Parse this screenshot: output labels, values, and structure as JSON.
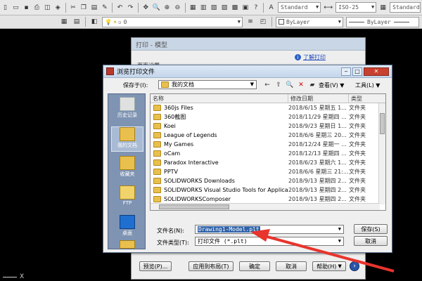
{
  "toolbar": {
    "text_style": "Standard",
    "dim_style": "ISO-25",
    "table_style": "Standard",
    "layer_value": "0",
    "color_value": "ByLayer",
    "linetype_value": "ByLayer"
  },
  "print_dialog": {
    "title": "打印 - 模型",
    "link": "了解打印",
    "page_setup": "页面设置",
    "buttons": {
      "preview": "预览(P)...",
      "apply_layout": "应用到布局(T)",
      "ok": "确定",
      "cancel": "取消",
      "help": "帮助(H)"
    }
  },
  "file_dialog": {
    "title": "浏览打印文件",
    "save_in_label": "保存于(I):",
    "save_in_value": "我的文档",
    "view_label": "查看(V)",
    "tools_label": "工具(L)",
    "places": [
      {
        "label": "历史记录"
      },
      {
        "label": "我的文档"
      },
      {
        "label": "收藏夹"
      },
      {
        "label": "FTP"
      },
      {
        "label": "桌面"
      }
    ],
    "columns": {
      "name": "名称",
      "date": "修改日期",
      "type": "类型"
    },
    "files": [
      {
        "name": "360js Files",
        "date": "2018/6/15 星期五 1...",
        "type": "文件夹"
      },
      {
        "name": "360截图",
        "date": "2018/11/29 星期四 ...",
        "type": "文件夹"
      },
      {
        "name": "Koei",
        "date": "2018/9/23 星期日 1...",
        "type": "文件夹"
      },
      {
        "name": "League of Legends",
        "date": "2018/6/6 星期三 20...",
        "type": "文件夹"
      },
      {
        "name": "My Games",
        "date": "2018/12/24 星期一 ...",
        "type": "文件夹"
      },
      {
        "name": "oCam",
        "date": "2018/12/13 星期四 ...",
        "type": "文件夹"
      },
      {
        "name": "Paradox Interactive",
        "date": "2018/6/23 星期六 1...",
        "type": "文件夹"
      },
      {
        "name": "PPTV",
        "date": "2018/6/6 星期三 21:...",
        "type": "文件夹"
      },
      {
        "name": "SOLIDWORKS Downloads",
        "date": "2018/9/13 星期四 2...",
        "type": "文件夹"
      },
      {
        "name": "SOLIDWORKS Visual Studio Tools for Applica...",
        "date": "2018/9/13 星期四 2...",
        "type": "文件夹"
      },
      {
        "name": "SOLIDWORKSComposer",
        "date": "2018/9/13 星期四 2...",
        "type": "文件夹"
      }
    ],
    "filename_label": "文件名(N):",
    "filename_value": "Drawing1-Model.plt",
    "filetype_label": "文件类型(T):",
    "filetype_value": "打印文件 (*.plt)",
    "save_button": "保存(S)",
    "cancel_button": "取消"
  },
  "command_line": "X",
  "colors": {
    "arrow": "#e8342c",
    "selection": "#3163a8",
    "folder": "#e9c04e"
  }
}
